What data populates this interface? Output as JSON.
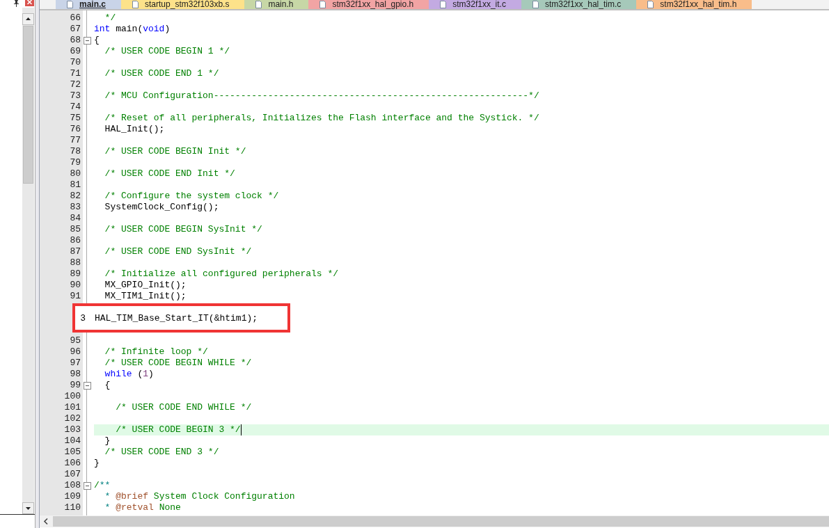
{
  "tabs": [
    {
      "label": "main.c",
      "selected": true,
      "color": "#c9d4e8"
    },
    {
      "label": "startup_stm32f103xb.s",
      "selected": false,
      "color": "#fde28a"
    },
    {
      "label": "main.h",
      "selected": false,
      "color": "#c7d7a6"
    },
    {
      "label": "stm32f1xx_hal_gpio.h",
      "selected": false,
      "color": "#f2a4a4"
    },
    {
      "label": "stm32f1xx_it.c",
      "selected": false,
      "color": "#c3aae2"
    },
    {
      "label": "stm32f1xx_hal_tim.c",
      "selected": false,
      "color": "#a6c9ba"
    },
    {
      "label": "stm32f1xx_hal_tim.h",
      "selected": false,
      "color": "#f9bd8a"
    }
  ],
  "lines": [
    {
      "kind": "code",
      "n": "66",
      "collapsible": false,
      "current": false,
      "segs": [
        {
          "kind": "comment",
          "text": "  */"
        }
      ]
    },
    {
      "kind": "code",
      "n": "67",
      "collapsible": false,
      "current": false,
      "segs": [
        {
          "kind": "keyword",
          "text": "int"
        },
        {
          "kind": "code",
          "text": " main("
        },
        {
          "kind": "keyword",
          "text": "void"
        },
        {
          "kind": "code",
          "text": ")"
        }
      ]
    },
    {
      "kind": "code",
      "n": "68",
      "collapsible": true,
      "current": false,
      "segs": [
        {
          "kind": "code",
          "text": "{"
        }
      ]
    },
    {
      "kind": "code",
      "n": "69",
      "collapsible": false,
      "current": false,
      "segs": [
        {
          "kind": "comment",
          "text": "  /* USER CODE BEGIN 1 */"
        }
      ]
    },
    {
      "kind": "code",
      "n": "70",
      "collapsible": false,
      "current": false
    },
    {
      "kind": "code",
      "n": "71",
      "collapsible": false,
      "current": false,
      "segs": [
        {
          "kind": "comment",
          "text": "  /* USER CODE END 1 */"
        }
      ]
    },
    {
      "kind": "code",
      "n": "72",
      "collapsible": false,
      "current": false
    },
    {
      "kind": "code",
      "n": "73",
      "collapsible": false,
      "current": false,
      "segs": [
        {
          "kind": "comment",
          "text": "  /* MCU Configuration----------------------------------------------------------*/"
        }
      ]
    },
    {
      "kind": "code",
      "n": "74",
      "collapsible": false,
      "current": false
    },
    {
      "kind": "code",
      "n": "75",
      "collapsible": false,
      "current": false,
      "segs": [
        {
          "kind": "comment",
          "text": "  /* Reset of all peripherals, Initializes the Flash interface and the Systick. */"
        }
      ]
    },
    {
      "kind": "code",
      "n": "76",
      "collapsible": false,
      "current": false,
      "segs": [
        {
          "kind": "code",
          "text": "  HAL_Init();"
        }
      ]
    },
    {
      "kind": "code",
      "n": "77",
      "collapsible": false,
      "current": false
    },
    {
      "kind": "code",
      "n": "78",
      "collapsible": false,
      "current": false,
      "segs": [
        {
          "kind": "comment",
          "text": "  /* USER CODE BEGIN Init */"
        }
      ]
    },
    {
      "kind": "code",
      "n": "79",
      "collapsible": false,
      "current": false
    },
    {
      "kind": "code",
      "n": "80",
      "collapsible": false,
      "current": false,
      "segs": [
        {
          "kind": "comment",
          "text": "  /* USER CODE END Init */"
        }
      ]
    },
    {
      "kind": "code",
      "n": "81",
      "collapsible": false,
      "current": false
    },
    {
      "kind": "code",
      "n": "82",
      "collapsible": false,
      "current": false,
      "segs": [
        {
          "kind": "comment",
          "text": "  /* Configure the system clock */"
        }
      ]
    },
    {
      "kind": "code",
      "n": "83",
      "collapsible": false,
      "current": false,
      "segs": [
        {
          "kind": "code",
          "text": "  SystemClock_Config();"
        }
      ]
    },
    {
      "kind": "code",
      "n": "84",
      "collapsible": false,
      "current": false
    },
    {
      "kind": "code",
      "n": "85",
      "collapsible": false,
      "current": false,
      "segs": [
        {
          "kind": "comment",
          "text": "  /* USER CODE BEGIN SysInit */"
        }
      ]
    },
    {
      "kind": "code",
      "n": "86",
      "collapsible": false,
      "current": false
    },
    {
      "kind": "code",
      "n": "87",
      "collapsible": false,
      "current": false,
      "segs": [
        {
          "kind": "comment",
          "text": "  /* USER CODE END SysInit */"
        }
      ]
    },
    {
      "kind": "code",
      "n": "88",
      "collapsible": false,
      "current": false
    },
    {
      "kind": "code",
      "n": "89",
      "collapsible": false,
      "current": false,
      "segs": [
        {
          "kind": "comment",
          "text": "  /* Initialize all configured peripherals */"
        }
      ]
    },
    {
      "kind": "code",
      "n": "90",
      "collapsible": false,
      "current": false,
      "segs": [
        {
          "kind": "code",
          "text": "  MX_GPIO_Init();"
        }
      ]
    },
    {
      "kind": "code",
      "n": "91",
      "collapsible": false,
      "current": false,
      "segs": [
        {
          "kind": "code",
          "text": "  MX_TIM1_Init();"
        }
      ]
    },
    {
      "kind": "pasted",
      "n": "3",
      "code": "HAL_TIM_Base_Start_IT(&htim1);"
    },
    {
      "kind": "code",
      "n": "95",
      "collapsible": false,
      "current": false
    },
    {
      "kind": "code",
      "n": "96",
      "collapsible": false,
      "current": false,
      "segs": [
        {
          "kind": "comment",
          "text": "  /* Infinite loop */"
        }
      ]
    },
    {
      "kind": "code",
      "n": "97",
      "collapsible": false,
      "current": false,
      "segs": [
        {
          "kind": "comment",
          "text": "  /* USER CODE BEGIN WHILE */"
        }
      ]
    },
    {
      "kind": "code",
      "n": "98",
      "collapsible": false,
      "current": false,
      "segs": [
        {
          "kind": "keyword",
          "text": "  while"
        },
        {
          "kind": "code",
          "text": " ("
        },
        {
          "kind": "number",
          "text": "1"
        },
        {
          "kind": "code",
          "text": ")"
        }
      ]
    },
    {
      "kind": "code",
      "n": "99",
      "collapsible": true,
      "current": false,
      "segs": [
        {
          "kind": "code",
          "text": "  {"
        }
      ]
    },
    {
      "kind": "code",
      "n": "100",
      "collapsible": false,
      "current": false
    },
    {
      "kind": "code",
      "n": "101",
      "collapsible": false,
      "current": false,
      "segs": [
        {
          "kind": "comment",
          "text": "    /* USER CODE END WHILE */"
        }
      ]
    },
    {
      "kind": "code",
      "n": "102",
      "collapsible": false,
      "current": false
    },
    {
      "kind": "code",
      "n": "103",
      "collapsible": false,
      "current": true,
      "segs": [
        {
          "kind": "comment",
          "text": "    /* USER CODE BEGIN 3 */"
        }
      ]
    },
    {
      "kind": "code",
      "n": "104",
      "collapsible": false,
      "current": false,
      "segs": [
        {
          "kind": "code",
          "text": "  }"
        }
      ]
    },
    {
      "kind": "code",
      "n": "105",
      "collapsible": false,
      "current": false,
      "segs": [
        {
          "kind": "comment",
          "text": "  /* USER CODE END 3 */"
        }
      ]
    },
    {
      "kind": "code",
      "n": "106",
      "collapsible": false,
      "current": false,
      "segs": [
        {
          "kind": "code",
          "text": "}"
        }
      ]
    },
    {
      "kind": "code",
      "n": "107",
      "collapsible": false,
      "current": false
    },
    {
      "kind": "code",
      "n": "108",
      "collapsible": true,
      "current": false,
      "segs": [
        {
          "kind": "comment",
          "text": "/"
        },
        {
          "kind": "doc-star",
          "text": "**"
        }
      ]
    },
    {
      "kind": "code",
      "n": "109",
      "collapsible": false,
      "current": false,
      "segs": [
        {
          "kind": "doc-star",
          "text": "  * "
        },
        {
          "kind": "doc-tag",
          "text": "@brief"
        },
        {
          "kind": "comment",
          "text": " System Clock Configuration"
        }
      ]
    },
    {
      "kind": "code",
      "n": "110",
      "collapsible": false,
      "current": false,
      "segs": [
        {
          "kind": "doc-star",
          "text": "  * "
        },
        {
          "kind": "doc-tag",
          "text": "@retval"
        },
        {
          "kind": "comment",
          "text": " None"
        }
      ]
    }
  ]
}
